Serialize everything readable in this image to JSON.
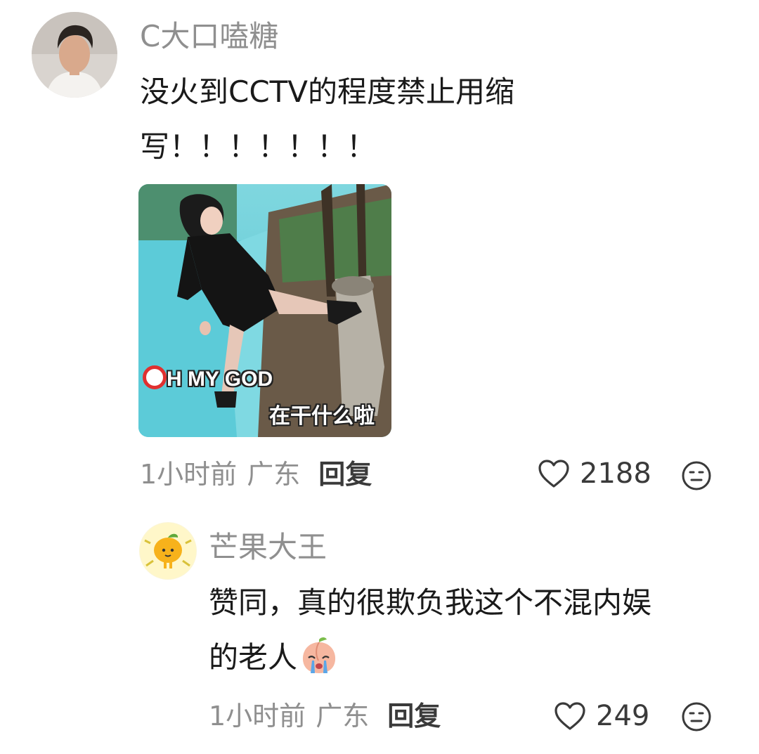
{
  "comments": [
    {
      "username": "C大口嗑糖",
      "text_line1": "没火到CCTV的程度禁止用缩",
      "text_line2": "写！！！！！！！",
      "gif_caption1": "H MY GOD",
      "gif_caption2": "在干什么啦",
      "time": "1小时前",
      "location": "广东",
      "reply_label": "回复",
      "likes": "2188"
    },
    {
      "username": "芒果大王",
      "text_line1": "赞同，真的很欺负我这个不混内娱",
      "text_line2": "的老人",
      "time": "1小时前",
      "location": "广东",
      "reply_label": "回复",
      "likes": "249"
    }
  ],
  "colors": {
    "username": "#8f8f8f",
    "body": "#1a1a1a",
    "meta": "#8f8f8f",
    "reply": "#3a3a3a",
    "icon": "#3a3a3a"
  },
  "icons": {
    "like": "heart-outline-icon",
    "reaction": "neutral-face-icon",
    "emoji": "crying-peach-emoji"
  }
}
